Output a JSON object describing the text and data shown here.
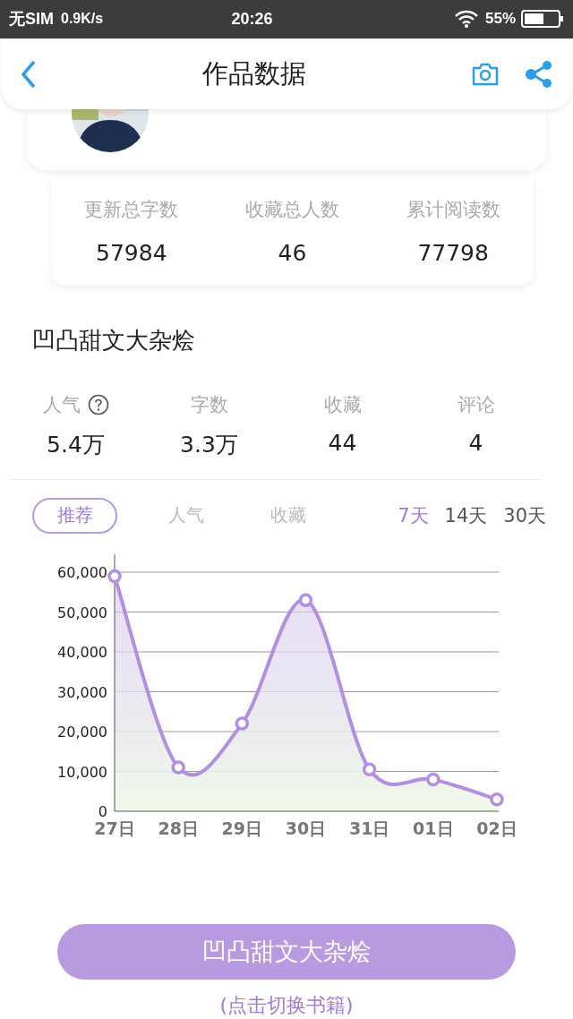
{
  "status_bar": {
    "carrier": "无SIM",
    "speed": "0.9K/s",
    "time": "20:26",
    "battery": "55%"
  },
  "header": {
    "title": "作品数据"
  },
  "totals": [
    {
      "label": "更新总字数",
      "value": "57984"
    },
    {
      "label": "收藏总人数",
      "value": "46"
    },
    {
      "label": "累计阅读数",
      "value": "77798"
    }
  ],
  "book": {
    "title": "凹凸甜文大杂烩"
  },
  "metrics": [
    {
      "label": "人气",
      "value": "5.4万",
      "help": true
    },
    {
      "label": "字数",
      "value": "3.3万",
      "help": false
    },
    {
      "label": "收藏",
      "value": "44",
      "help": false
    },
    {
      "label": "评论",
      "value": "4",
      "help": false
    }
  ],
  "tabs": [
    {
      "label": "推荐",
      "selected": true
    },
    {
      "label": "人气",
      "selected": false
    },
    {
      "label": "收藏",
      "selected": false
    }
  ],
  "ranges": [
    {
      "label": "7天",
      "selected": true
    },
    {
      "label": "14天",
      "selected": false
    },
    {
      "label": "30天",
      "selected": false
    }
  ],
  "chart_data": {
    "type": "area",
    "categories": [
      "27日",
      "28日",
      "29日",
      "30日",
      "31日",
      "01日",
      "02日"
    ],
    "grid": true,
    "series": [
      {
        "color": "#b48ee0",
        "values": [
          59000,
          11000,
          22000,
          53000,
          10500,
          8000,
          3000
        ]
      }
    ],
    "ylim": [
      0,
      60000
    ],
    "yticks": [
      {
        "value": 0,
        "label": "0"
      },
      {
        "value": 10000,
        "label": "10,000"
      },
      {
        "value": 20000,
        "label": "20,000"
      },
      {
        "value": 30000,
        "label": "30,000"
      },
      {
        "value": 40000,
        "label": "40,000"
      },
      {
        "value": 50000,
        "label": "50,000"
      },
      {
        "value": 60000,
        "label": "60,000"
      }
    ]
  },
  "switch_button": {
    "label": "凹凸甜文大杂烩"
  },
  "hint": "(点击切换书籍)"
}
